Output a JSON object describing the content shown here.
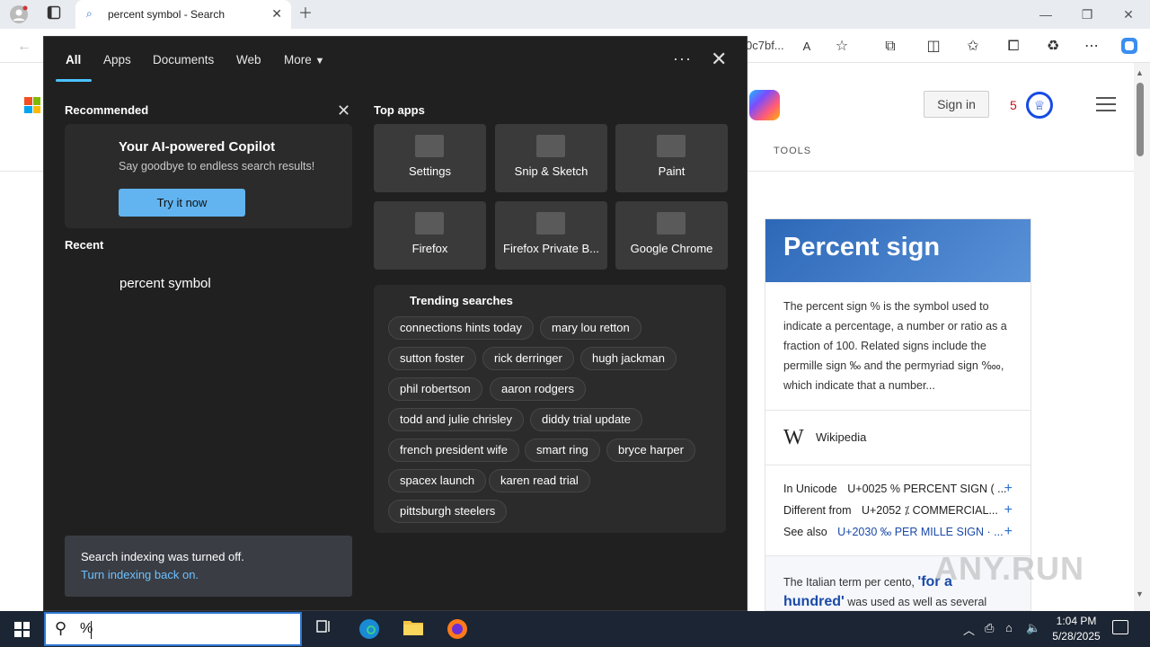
{
  "browser": {
    "tab_title": "percent symbol - Search",
    "address_fragment": "0c7bf..."
  },
  "page": {
    "signin_label": "Sign in",
    "rewards_count": "5",
    "tools_label": "TOOLS",
    "knowledge_card": {
      "title": "Percent sign",
      "description": "The percent sign % is the symbol used to indicate a percentage, a number or ratio as a fraction of 100. Related signs include the permille sign ‰ and the permyriad sign ‱, which indicate that a number...",
      "source": "Wikipedia",
      "facts": [
        {
          "key": "In Unicode",
          "value": "U+0025 % PERCENT SIGN ( ..."
        },
        {
          "key": "Different from",
          "value": "U+2052 ⁒ COMMERCIAL..."
        },
        {
          "key": "See also",
          "value": "U+2030 ‰ PER MILLE SIGN · ..."
        }
      ],
      "footer_text": "The Italian term per cento, ",
      "footer_quote": "'for a hundred'",
      "footer_tail": " was used as well as several"
    },
    "watermark": "ANY.RUN"
  },
  "search_panel": {
    "tabs": [
      "All",
      "Apps",
      "Documents",
      "Web",
      "More"
    ],
    "recommended": {
      "title": "Recommended",
      "card_title": "Your AI-powered Copilot",
      "card_subtitle": "Say goodbye to endless search results!",
      "card_button": "Try it now"
    },
    "recent": {
      "title": "Recent",
      "items": [
        "percent symbol"
      ]
    },
    "notice": {
      "text": "Search indexing was turned off.",
      "link": "Turn indexing back on."
    },
    "top_apps": {
      "title": "Top apps",
      "apps": [
        "Settings",
        "Snip & Sketch",
        "Paint",
        "Firefox",
        "Firefox Private B...",
        "Google Chrome"
      ]
    },
    "trending": {
      "title": "Trending searches",
      "items": [
        "connections hints today",
        "mary lou retton",
        "sutton foster",
        "rick derringer",
        "hugh jackman",
        "phil robertson",
        "aaron rodgers",
        "todd and julie chrisley",
        "diddy trial update",
        "french president wife",
        "smart ring",
        "bryce harper",
        "spacex launch",
        "karen read trial",
        "pittsburgh steelers"
      ]
    }
  },
  "taskbar": {
    "search_value": "%",
    "time": "1:04 PM",
    "date": "5/28/2025"
  }
}
